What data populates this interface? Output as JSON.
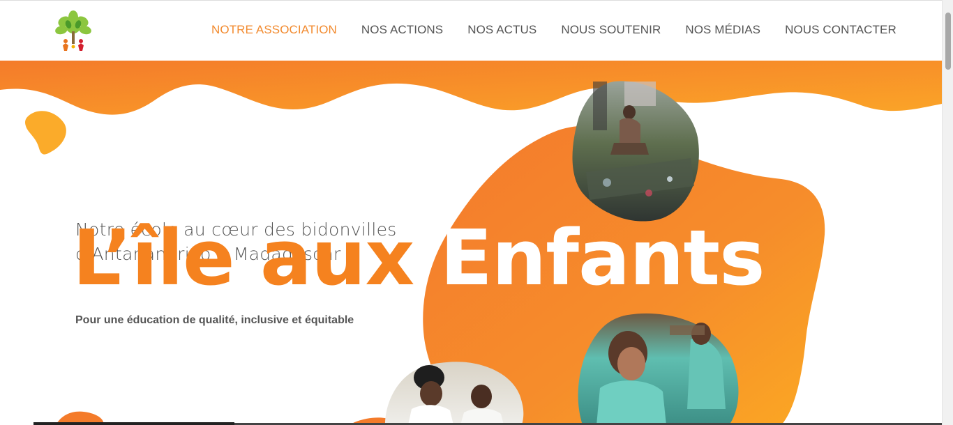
{
  "header": {
    "logo_name": "association-logo",
    "nav": [
      {
        "label": "NOTRE ASSOCIATION",
        "active": true
      },
      {
        "label": "NOS ACTIONS",
        "active": false
      },
      {
        "label": "NOS ACTUS",
        "active": false
      },
      {
        "label": "NOUS SOUTENIR",
        "active": false
      },
      {
        "label": "NOS MÉDIAS",
        "active": false
      },
      {
        "label": "NOUS CONTACTER",
        "active": false
      }
    ]
  },
  "hero": {
    "subtitle_line1": "Notre école au cœur des bidonvilles",
    "subtitle_line2": "d'Antananarivo à Madagascar",
    "title_orange": "L’île aux",
    "title_white": "Enfants",
    "tagline": "Pour une éducation de qualité, inclusive et équitable"
  },
  "colors": {
    "accent": "#f5821f",
    "accent_light": "#fbab2a",
    "text": "#555555"
  }
}
